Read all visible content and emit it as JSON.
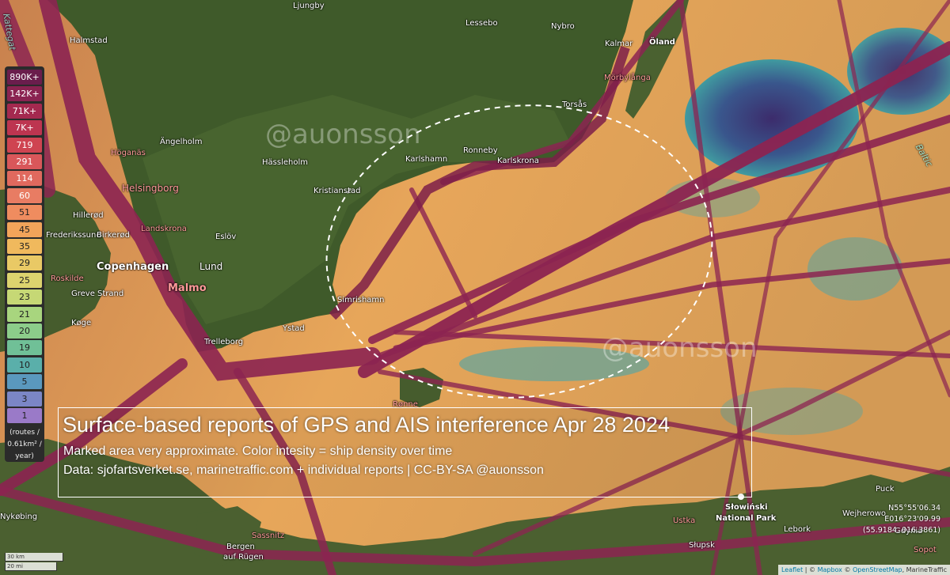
{
  "title": "Surface-based reports of GPS and AIS interference Apr 28 2024",
  "subtitle_1": "Marked area very approximate. Color intesity = ship density over time",
  "subtitle_2": "Data: sjofartsverket.se, marinetraffic.com + individual reports | CC-BY-SA @auonsson",
  "watermarks": [
    "@auonsson",
    "@auonsson"
  ],
  "legend": {
    "values": [
      "890K+",
      "142K+",
      "71K+",
      "7K+",
      "719",
      "291",
      "114",
      "60",
      "51",
      "45",
      "35",
      "29",
      "25",
      "23",
      "21",
      "20",
      "19",
      "10",
      "5",
      "3",
      "1"
    ],
    "colors": [
      "#6a1d4c",
      "#8a2351",
      "#a4294f",
      "#bd3550",
      "#cf4451",
      "#d9575a",
      "#e0695e",
      "#e87c63",
      "#ef8c5f",
      "#f2a45a",
      "#f0b95d",
      "#e9c965",
      "#dcd36e",
      "#c6d875",
      "#a8d57e",
      "#8ccd8a",
      "#70c097",
      "#5aafaa",
      "#5a98be",
      "#7b86c6",
      "#9a7ac8"
    ],
    "unit_lines": [
      "(routes /",
      "0.61km² /",
      "year)"
    ]
  },
  "places": {
    "ljungby": "Ljungby",
    "lessebo": "Lessebo",
    "nybro": "Nybro",
    "kalmar": "Kalmar",
    "oland": "Öland",
    "morbylanga": "Mörbylånga",
    "halmstad": "Halmstad",
    "torsas": "Torsås",
    "hoganas": "Höganäs",
    "angelholm": "Ängelholm",
    "hassleholm": "Hässleholm",
    "karlshamn": "Karlshamn",
    "ronneby": "Ronneby",
    "karlskrona": "Karlskrona",
    "helsingborg": "Helsingborg",
    "kristianstad": "Kristianstad",
    "hillerod": "Hillerød",
    "frederikssund": "Frederikssund",
    "birkerod": "Birkerød",
    "landskrona": "Landskrona",
    "eslov": "Eslöv",
    "copenhagen": "Copenhagen",
    "lund": "Lund",
    "roskilde": "Roskilde",
    "malmo": "Malmo",
    "greve_strand": "Greve Strand",
    "simrishamn": "Simrishamn",
    "koge": "Køge",
    "ystad": "Ystad",
    "trelleborg": "Trelleborg",
    "ronne": "Rønne",
    "nykobing": "Nykøbing",
    "sassnitz": "Sassnitz",
    "bergen_1": "Bergen",
    "bergen_2": "auf Rügen",
    "ustka": "Ustka",
    "slowinski_1": "Słowiński",
    "slowinski_2": "National Park",
    "lebork": "Lebork",
    "wejherowo": "Wejherowo",
    "puck": "Puck",
    "gdynia": "Gdynia",
    "slupsk": "Słupsk",
    "sopot": "Sopot",
    "kattegat": "Kattegat",
    "baltic": "Baltic"
  },
  "coords": {
    "lat": "N55°55'06.34",
    "lon": "E016°23'09.99",
    "decimal": "(55.9184, 016.3861)"
  },
  "scale": {
    "km": "30 km",
    "mi": "20 mi"
  },
  "attribution": {
    "leaflet": "Leaflet",
    "sep1": " | © ",
    "mapbox": "Mapbox",
    "sep2": " © ",
    "osm": "OpenStreetMap",
    "sep3": ", MarineTraffic"
  },
  "colors": {
    "land": "#3f5a2a",
    "sea_density_high": "#8a2351",
    "sea_density_mid": "#e8a05a",
    "sea_density_low": "#2e9aa8",
    "sea_deep": "#2b2f7a",
    "title_box": "#ffffff"
  }
}
